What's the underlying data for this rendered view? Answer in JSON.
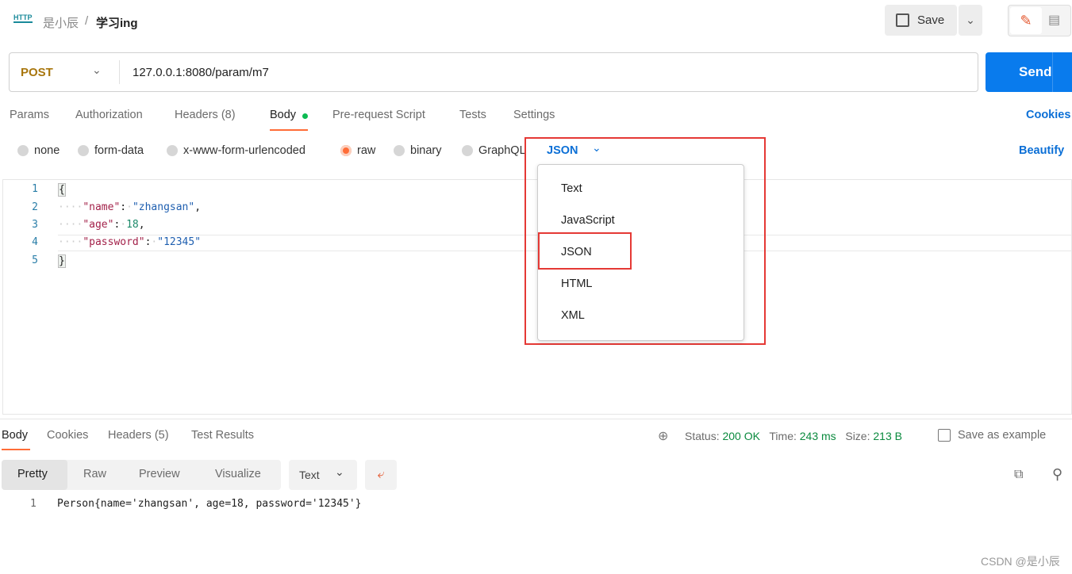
{
  "header": {
    "icon": "http-icon",
    "workspace": "是小辰",
    "separator": "/",
    "request_name": "学习ing",
    "save_label": "Save"
  },
  "request": {
    "method": "POST",
    "url": "127.0.0.1:8080/param/m7",
    "send_label": "Send"
  },
  "tabs": [
    {
      "label": "Params"
    },
    {
      "label": "Authorization"
    },
    {
      "label": "Headers (8)"
    },
    {
      "label": "Body"
    },
    {
      "label": "Pre-request Script"
    },
    {
      "label": "Tests"
    },
    {
      "label": "Settings"
    }
  ],
  "cookies_label": "Cookies",
  "body_types": [
    {
      "label": "none"
    },
    {
      "label": "form-data"
    },
    {
      "label": "x-www-form-urlencoded"
    },
    {
      "label": "raw",
      "selected": true
    },
    {
      "label": "binary"
    },
    {
      "label": "GraphQL"
    }
  ],
  "raw_format": "JSON",
  "beautify_label": "Beautify",
  "format_menu": [
    "Text",
    "JavaScript",
    "JSON",
    "HTML",
    "XML"
  ],
  "editor": {
    "lines": [
      "1",
      "2",
      "3",
      "4",
      "5"
    ],
    "open": "{",
    "k1": "\"name\"",
    "v1": "\"zhangsan\"",
    "k2": "\"age\"",
    "v2": "18",
    "k3": "\"password\"",
    "v3": "\"12345\"",
    "close": "}"
  },
  "response": {
    "tabs": [
      "Body",
      "Cookies",
      "Headers (5)",
      "Test Results"
    ],
    "status_label": "Status:",
    "status": "200 OK",
    "time_label": "Time:",
    "time": "243 ms",
    "size_label": "Size:",
    "size": "213 B",
    "save_example": "Save as example",
    "views": [
      "Pretty",
      "Raw",
      "Preview",
      "Visualize"
    ],
    "format": "Text",
    "line": "1",
    "output": "Person{name='zhangsan', age=18, password='12345'}"
  },
  "watermark": "CSDN @是小辰",
  "colors": {
    "accent": "#ff6c37",
    "send": "#097bed",
    "post": "#a8760d",
    "status_ok": "#0a8a3e",
    "highlight": "#e53935"
  }
}
